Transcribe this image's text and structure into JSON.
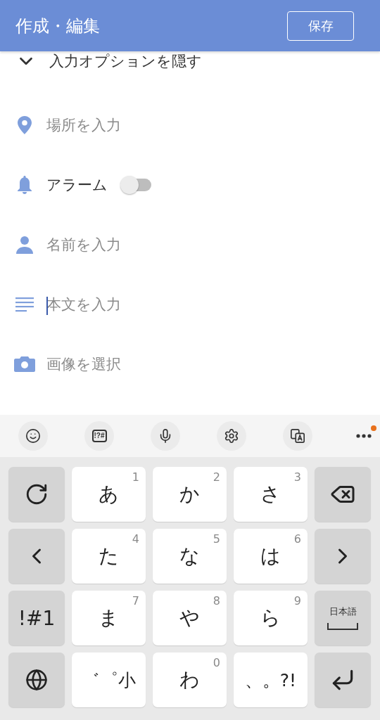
{
  "header": {
    "title": "作成・編集",
    "save_button": "保存"
  },
  "hide_options": {
    "label": "入力オプションを隠す",
    "expanded": true
  },
  "options": [
    {
      "kind": "field",
      "placeholder": "場所を入力",
      "focused": false
    },
    {
      "kind": "toggle",
      "label": "アラーム",
      "on": false
    },
    {
      "kind": "field",
      "placeholder": "名前を入力",
      "focused": false
    },
    {
      "kind": "field",
      "placeholder": "本文を入力",
      "focused": true
    },
    {
      "kind": "picker",
      "label": "画像を選択"
    }
  ],
  "keyboard_toolbar": [
    {
      "kind": "icon",
      "badge": false
    },
    {
      "kind": "text",
      "label": "!?#",
      "badge": false
    },
    {
      "kind": "icon",
      "badge": false
    },
    {
      "kind": "icon",
      "badge": false
    },
    {
      "kind": "icon",
      "badge": false
    },
    {
      "kind": "more",
      "badge": true
    }
  ],
  "keys": [
    [
      {
        "kind": "icon"
      },
      {
        "kind": "char",
        "label": "あ",
        "hint": "1"
      },
      {
        "kind": "char",
        "label": "か",
        "hint": "2"
      },
      {
        "kind": "char",
        "label": "さ",
        "hint": "3"
      },
      {
        "kind": "icon"
      }
    ],
    [
      {
        "kind": "icon"
      },
      {
        "kind": "char",
        "label": "た",
        "hint": "4"
      },
      {
        "kind": "char",
        "label": "な",
        "hint": "5"
      },
      {
        "kind": "char",
        "label": "は",
        "hint": "6"
      },
      {
        "kind": "icon"
      }
    ],
    [
      {
        "kind": "text",
        "label": "!#1"
      },
      {
        "kind": "char",
        "label": "ま",
        "hint": "7"
      },
      {
        "kind": "char",
        "label": "や",
        "hint": "8"
      },
      {
        "kind": "char",
        "label": "ら",
        "hint": "9"
      },
      {
        "kind": "space",
        "label": "日本語"
      }
    ],
    [
      {
        "kind": "icon"
      },
      {
        "kind": "char",
        "label": "゛゜小"
      },
      {
        "kind": "char",
        "label": "わ",
        "hint": "0"
      },
      {
        "kind": "char",
        "label": "、。?!"
      },
      {
        "kind": "icon"
      }
    ]
  ]
}
